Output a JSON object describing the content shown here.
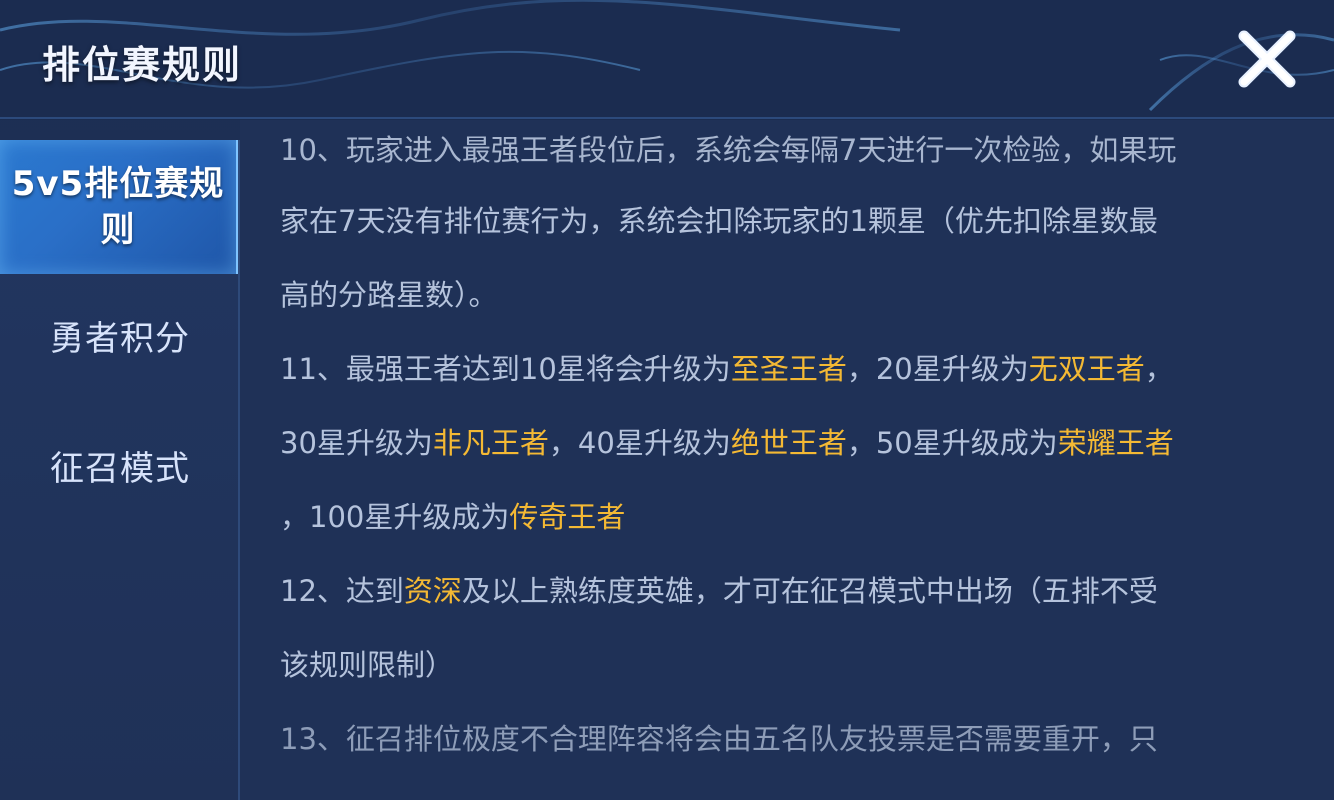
{
  "header": {
    "title": "排位赛规则"
  },
  "sidebar": {
    "items": [
      {
        "label_line1": "5v5排位赛规",
        "label_line2": "则",
        "active": true
      },
      {
        "label": "勇者积分",
        "active": false
      },
      {
        "label": "征召模式",
        "active": false
      }
    ]
  },
  "content": {
    "lines": [
      {
        "segments": [
          {
            "text": "10、玩家进入最强王者段位后，系统会每隔7天进行一次检验，如果玩"
          }
        ]
      },
      {
        "segments": [
          {
            "text": "家在7天没有排位赛行为，系统会扣除玩家的1颗星（优先扣除星数最"
          }
        ]
      },
      {
        "segments": [
          {
            "text": "高的分路星数）。"
          }
        ]
      },
      {
        "segments": [
          {
            "text": "11、最强王者达到10星将会升级为"
          },
          {
            "text": "至圣王者",
            "highlight": true
          },
          {
            "text": "，20星升级为"
          },
          {
            "text": "无双王者",
            "highlight": true
          },
          {
            "text": "，"
          }
        ]
      },
      {
        "segments": [
          {
            "text": "30星升级为"
          },
          {
            "text": "非凡王者",
            "highlight": true
          },
          {
            "text": "，40星升级为"
          },
          {
            "text": "绝世王者",
            "highlight": true
          },
          {
            "text": "，50星升级成为"
          },
          {
            "text": "荣耀王者",
            "highlight": true
          }
        ]
      },
      {
        "segments": [
          {
            "text": "，100星升级成为"
          },
          {
            "text": "传奇王者",
            "highlight": true
          }
        ]
      },
      {
        "segments": [
          {
            "text": "12、达到"
          },
          {
            "text": "资深",
            "highlight": true
          },
          {
            "text": "及以上熟练度英雄，才可在征召模式中出场（五排不受"
          }
        ]
      },
      {
        "segments": [
          {
            "text": "该规则限制）"
          }
        ]
      },
      {
        "segments": [
          {
            "text": "13、征召排位极度不合理阵容将会由五名队友投票是否需要重开，只"
          }
        ]
      }
    ]
  },
  "colors": {
    "highlight": "#f4b934",
    "text": "#b5c3dc",
    "active_tab": "#2b79d0",
    "background": "#1f3157"
  },
  "icons": {
    "close": "close-icon"
  }
}
